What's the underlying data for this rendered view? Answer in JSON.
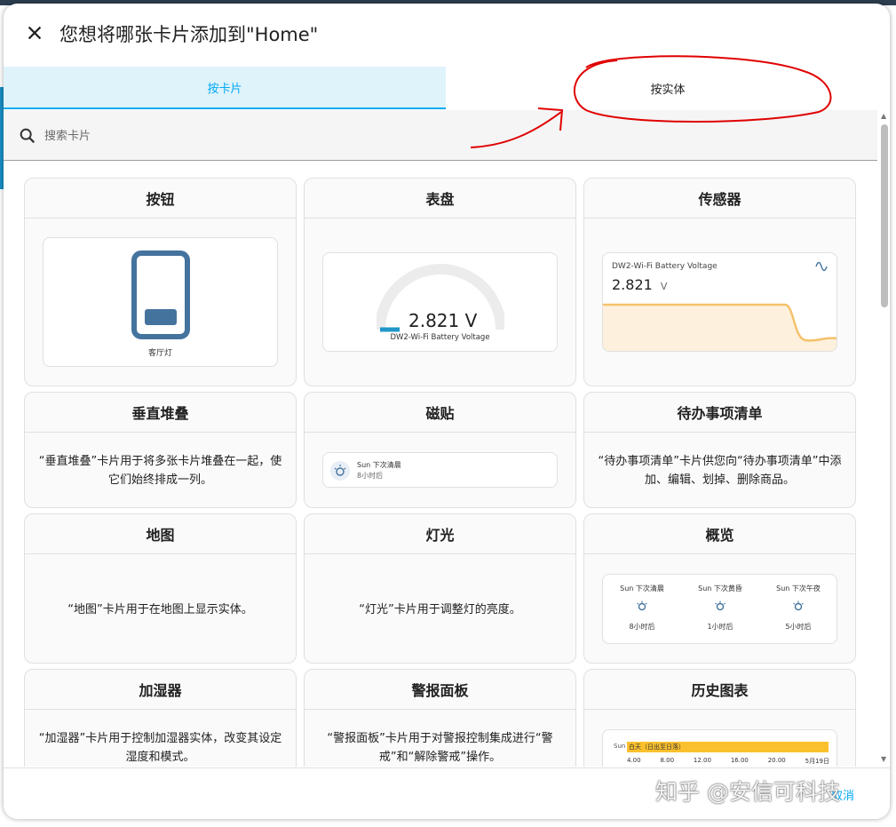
{
  "dialog": {
    "title": "您想将哪张卡片添加到\"Home\"",
    "tabs": [
      {
        "label": "按卡片",
        "active": true
      },
      {
        "label": "按实体",
        "active": false
      }
    ],
    "search": {
      "placeholder": "搜索卡片"
    },
    "footer": {
      "cancel_label": "取消"
    }
  },
  "cards": {
    "button": {
      "title": "按钮",
      "entity": "客厅灯"
    },
    "gauge": {
      "title": "表盘",
      "value": "2.821 V",
      "entity": "DW2-Wi-Fi Battery Voltage"
    },
    "sensor": {
      "title": "传感器",
      "entity": "DW2-Wi-Fi Battery Voltage",
      "value": "2.821",
      "unit": "V"
    },
    "vertical_stack": {
      "title": "垂直堆叠",
      "description": "“垂直堆叠”卡片用于将多张卡片堆叠在一起，使它们始终排成一列。"
    },
    "tile": {
      "title": "磁贴",
      "name": "Sun 下次清晨",
      "sub": "8小时后"
    },
    "todo": {
      "title": "待办事项清单",
      "description": "“待办事项清单”卡片供您向“待办事项清单”中添加、编辑、划掉、删除商品。"
    },
    "map": {
      "title": "地图",
      "description": "“地图”卡片用于在地图上显示实体。"
    },
    "light": {
      "title": "灯光",
      "description": "“灯光”卡片用于调整灯的亮度。"
    },
    "glance": {
      "title": "概览",
      "items": [
        {
          "name": "Sun 下次清晨",
          "state": "8小时后"
        },
        {
          "name": "Sun 下次黄昏",
          "state": "1小时后"
        },
        {
          "name": "Sun 下次午夜",
          "state": "5小时后"
        }
      ]
    },
    "humidifier": {
      "title": "加湿器",
      "description": "“加湿器”卡片用于控制加湿器实体，改变其设定湿度和模式。"
    },
    "alarm_panel": {
      "title": "警报面板",
      "description": "“警报面板”卡片用于对警报控制集成进行“警戒”和“解除警戒”操作。"
    },
    "history_graph": {
      "title": "历史图表",
      "entity": "Sun",
      "bar_label": "白天（日出至日落）",
      "ticks": [
        "4.00",
        "8.00",
        "12.00",
        "16.00",
        "20.00",
        "5月19日"
      ]
    }
  },
  "watermark": "知乎 @安信可科技",
  "colors": {
    "accent": "#03a9f4",
    "tab_active_bg": "#dff3fb",
    "button_icon": "#44739e",
    "sensor_line": "#f5c16c",
    "annotation": "#e00000",
    "history_bar": "#fbc02d"
  }
}
